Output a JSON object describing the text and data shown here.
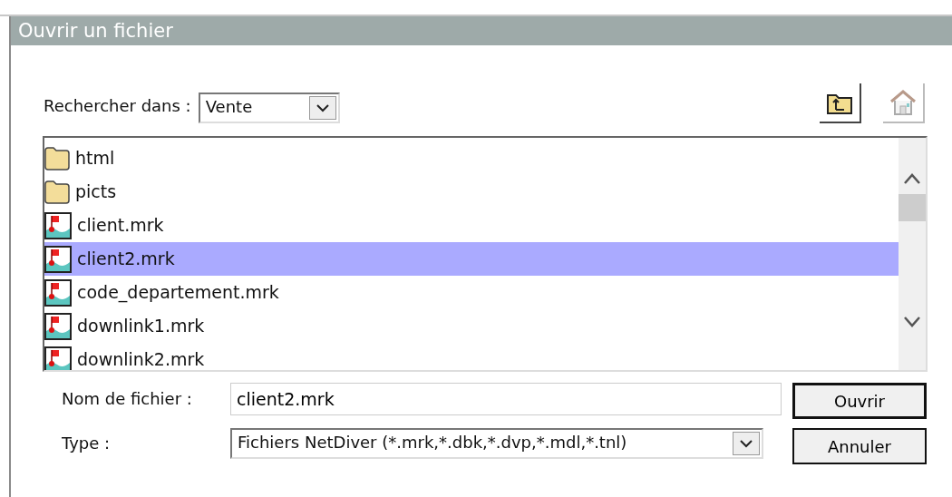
{
  "window": {
    "title": "Ouvrir un fichier"
  },
  "look_in": {
    "label": "Rechercher dans :",
    "value": "Vente"
  },
  "toolbar_buttons": [
    {
      "kind": "up",
      "disabled": false
    },
    {
      "kind": "home",
      "disabled": true
    }
  ],
  "files": [
    {
      "name": "html",
      "kind": "folder",
      "selected": false
    },
    {
      "name": "picts",
      "kind": "folder",
      "selected": false
    },
    {
      "name": "client.mrk",
      "kind": "mrk",
      "selected": false
    },
    {
      "name": "client2.mrk",
      "kind": "mrk",
      "selected": true
    },
    {
      "name": "code_departement.mrk",
      "kind": "mrk",
      "selected": false
    },
    {
      "name": "downlink1.mrk",
      "kind": "mrk",
      "selected": false
    },
    {
      "name": "downlink2.mrk",
      "kind": "mrk",
      "selected": false
    }
  ],
  "file_name": {
    "label": "Nom de fichier :",
    "value": "client2.mrk"
  },
  "file_type": {
    "label": "Type :",
    "value": "Fichiers NetDiver (*.mrk,*.dbk,*.dvp,*.mdl,*.tnl)"
  },
  "buttons": [
    {
      "label": "Ouvrir",
      "default": true
    },
    {
      "label": "Annuler",
      "default": false
    }
  ]
}
